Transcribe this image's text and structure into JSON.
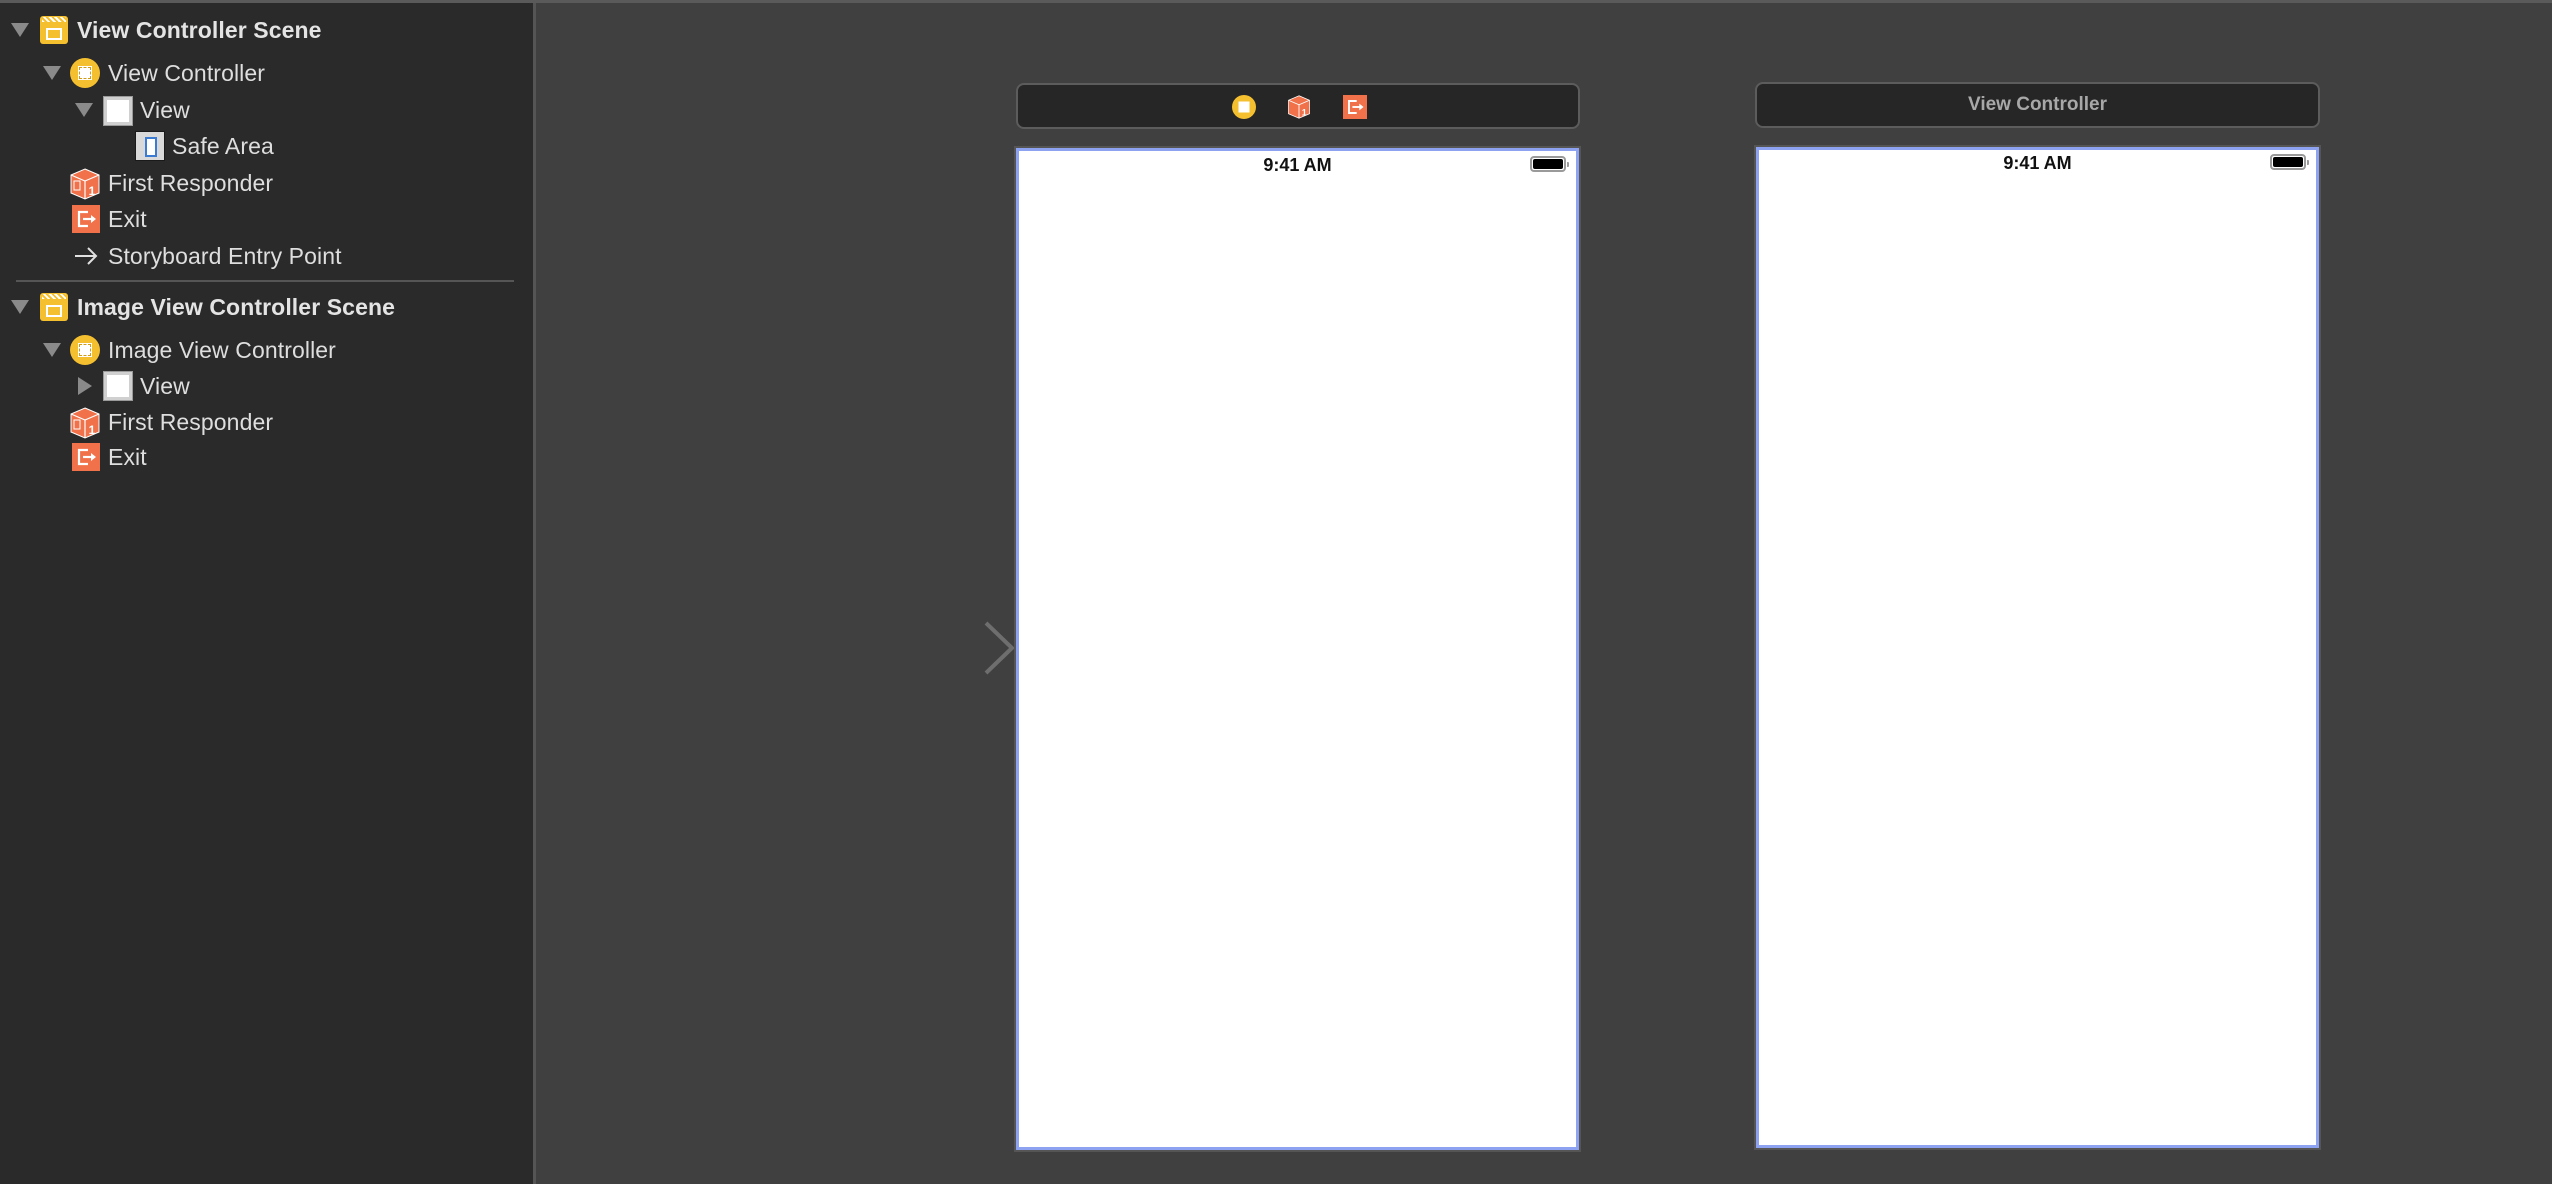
{
  "outline": {
    "scenes": [
      {
        "title": "View Controller Scene",
        "expanded": true,
        "items": [
          {
            "label": "View Controller",
            "icon": "view-controller-icon",
            "expanded": true
          },
          {
            "label": "View",
            "icon": "view-icon",
            "expanded": true
          },
          {
            "label": "Safe Area",
            "icon": "safe-area-icon"
          },
          {
            "label": "First Responder",
            "icon": "first-responder-icon"
          },
          {
            "label": "Exit",
            "icon": "exit-icon"
          },
          {
            "label": "Storyboard Entry Point",
            "icon": "entry-point-arrow-icon"
          }
        ]
      },
      {
        "title": "Image View Controller Scene",
        "expanded": true,
        "items": [
          {
            "label": "Image View Controller",
            "icon": "view-controller-icon",
            "expanded": true
          },
          {
            "label": "View",
            "icon": "view-icon",
            "expanded": false
          },
          {
            "label": "First Responder",
            "icon": "first-responder-icon"
          },
          {
            "label": "Exit",
            "icon": "exit-icon"
          }
        ]
      }
    ]
  },
  "canvas": {
    "scene1": {
      "dock_icons": [
        "view-controller-icon",
        "first-responder-icon",
        "exit-icon"
      ],
      "status_time": "9:41 AM",
      "is_entry_point": true
    },
    "scene2": {
      "dock_title": "View Controller",
      "status_time": "9:41 AM"
    }
  },
  "colors": {
    "sidebar_bg": "#2a2a2a",
    "canvas_bg": "#404040",
    "accent_yellow": "#f5c02f",
    "accent_orange": "#f0714a",
    "selection_border": "#8ea2f2"
  }
}
